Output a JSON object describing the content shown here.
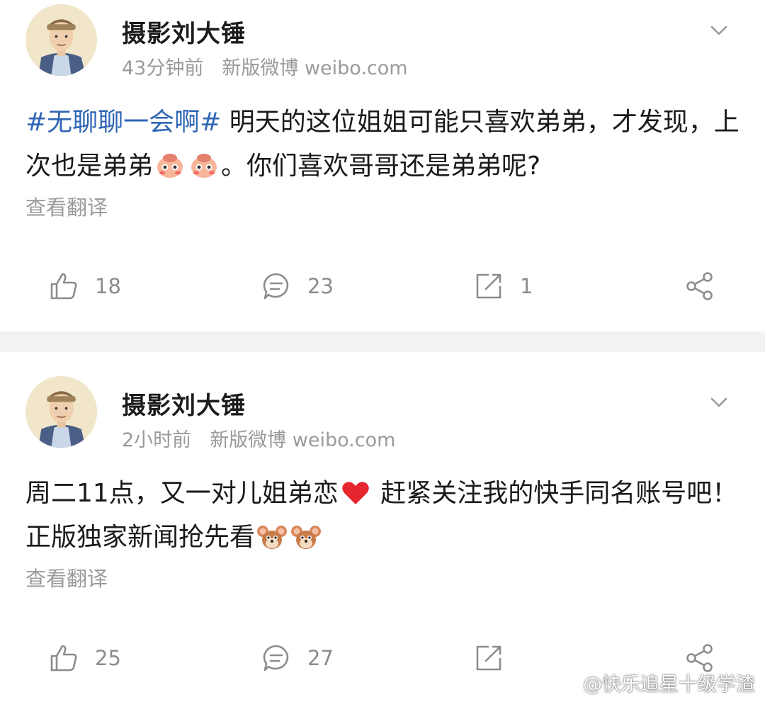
{
  "colors": {
    "topic": "#2f66b5",
    "meta_gray": "#9a9a9a",
    "divider": "#f2f2f2"
  },
  "posts": [
    {
      "author": "摄影刘大锤",
      "time": "43分钟前",
      "source": "新版微博 weibo.com",
      "topic": "#无聊聊一会啊#",
      "text_before": " 明天的这位姐姐可能只喜欢弟弟，才发现，上次也是弟弟",
      "emoji": [
        "shy-emoji",
        "shy-emoji"
      ],
      "text_after": "。你们喜欢哥哥还是弟弟呢?",
      "translate": "查看翻译",
      "likes": "18",
      "comments": "23",
      "reposts": "1"
    },
    {
      "author": "摄影刘大锤",
      "time": "2小时前",
      "source": "新版微博 weibo.com",
      "text_before": "周二11点，又一对儿姐弟恋",
      "emoji_mid": "heart-emoji",
      "text_middle": " 赶紧关注我的快手同名账号吧！正版独家新闻抢先看",
      "emoji": [
        "jerry-mouse-emoji",
        "jerry-mouse-emoji"
      ],
      "translate": "查看翻译",
      "likes": "25",
      "comments": "27",
      "reposts": ""
    }
  ],
  "watermark": "@快乐追星十级学渣"
}
